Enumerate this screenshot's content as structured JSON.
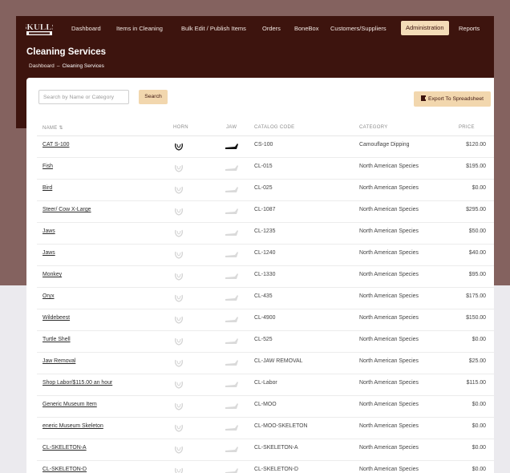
{
  "nav": {
    "logo_text": "SKULLS",
    "items": [
      "Dashboard",
      "Items in Cleaning",
      "Bulk Edit / Publish Items",
      "Orders",
      "BoneBox",
      "Customers/Suppliers",
      "Administration",
      "Reports"
    ],
    "active": "Administration"
  },
  "page": {
    "title": "Cleaning Services",
    "breadcrumb": [
      "Dashboard",
      "Cleaning Services"
    ]
  },
  "toolbar": {
    "search_placeholder": "Search by Name or Category",
    "search_label": "Search",
    "export_label": "Export To Spreadsheet"
  },
  "table": {
    "columns": [
      "NAME ⇅",
      "HORN",
      "JAW",
      "CATALOG CODE",
      "CATEGORY",
      "PRICE"
    ],
    "rows": [
      {
        "name": "CAT S-100",
        "code": "CS-100",
        "category": "Camouflage Dipping",
        "price": "$120.00",
        "active": true
      },
      {
        "name": "Fish",
        "code": "CL-015",
        "category": "North American Species",
        "price": "$195.00",
        "active": false
      },
      {
        "name": "Bird",
        "code": "CL-025",
        "category": "North American Species",
        "price": "$0.00",
        "active": false
      },
      {
        "name": "Steer/ Cow X-Large",
        "code": "CL-1087",
        "category": "North American Species",
        "price": "$295.00",
        "active": false
      },
      {
        "name": "Jaws",
        "code": "CL-1235",
        "category": "North American Species",
        "price": "$50.00",
        "active": false
      },
      {
        "name": "Jaws",
        "code": "CL-1240",
        "category": "North American Species",
        "price": "$40.00",
        "active": false
      },
      {
        "name": "Monkey",
        "code": "CL-1330",
        "category": "North American Species",
        "price": "$95.00",
        "active": false
      },
      {
        "name": "Oryx",
        "code": "CL-435",
        "category": "North American Species",
        "price": "$175.00",
        "active": false
      },
      {
        "name": "Wildebeest",
        "code": "CL-4900",
        "category": "North American Species",
        "price": "$150.00",
        "active": false
      },
      {
        "name": "Turtle Shell",
        "code": "CL-525",
        "category": "North American Species",
        "price": "$0.00",
        "active": false
      },
      {
        "name": "Jaw Removal",
        "code": "CL-JAW REMOVAL",
        "category": "North American Species",
        "price": "$25.00",
        "active": false
      },
      {
        "name": "Shop Labor/$115.00 an hour",
        "code": "CL-Labor",
        "category": "North American Species",
        "price": "$115.00",
        "active": false
      },
      {
        "name": "Generic Museum Item",
        "code": "CL-MOO",
        "category": "North American Species",
        "price": "$0.00",
        "active": false
      },
      {
        "name": "eneric Museum Skeleton",
        "code": "CL-MOO-SKELETON",
        "category": "North American Species",
        "price": "$0.00",
        "active": false
      },
      {
        "name": "CL-SKELETON-A",
        "code": "CL-SKELETON-A",
        "category": "North American Species",
        "price": "$0.00",
        "active": false
      },
      {
        "name": "CL-SKELETON-D",
        "code": "CL-SKELETON-D",
        "category": "North American Species",
        "price": "$0.00",
        "active": false
      }
    ]
  },
  "colors": {
    "header_bg": "#3d140e",
    "accent": "#f2d7ae",
    "outer_bg": "#84625f"
  },
  "icons": {
    "horn": "horn-icon",
    "jaw": "jaw-icon",
    "export": "spreadsheet-icon"
  }
}
